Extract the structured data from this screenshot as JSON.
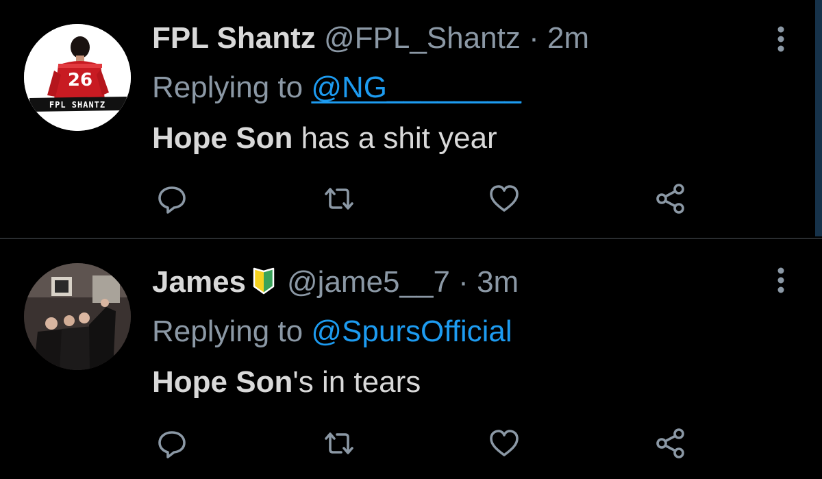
{
  "colors": {
    "background": "#000000",
    "text_primary": "#d9d9d9",
    "text_secondary": "#8b98a5",
    "link": "#1d9bf0",
    "divider": "#2a2d30"
  },
  "tweets": [
    {
      "display_name": "FPL Shantz",
      "handle": "@FPL_Shantz",
      "separator": "·",
      "time": "2m",
      "replying_prefix": "Replying to ",
      "replying_to": "@NG________",
      "body_bold": "Hope Son",
      "body_rest": " has a shit year",
      "avatar": {
        "jersey_number": "26",
        "banner_text": "FPL SHANTZ"
      },
      "actions": [
        "reply-icon",
        "retweet-icon",
        "like-icon",
        "share-icon"
      ]
    },
    {
      "display_name": "James",
      "badge": "beginner-badge-icon",
      "handle": "@jame5__7",
      "separator": "·",
      "time": "3m",
      "replying_prefix": "Replying to ",
      "replying_to": "@SpursOfficial",
      "body_bold": "Hope Son",
      "body_rest": "'s in tears",
      "actions": [
        "reply-icon",
        "retweet-icon",
        "like-icon",
        "share-icon"
      ]
    }
  ]
}
